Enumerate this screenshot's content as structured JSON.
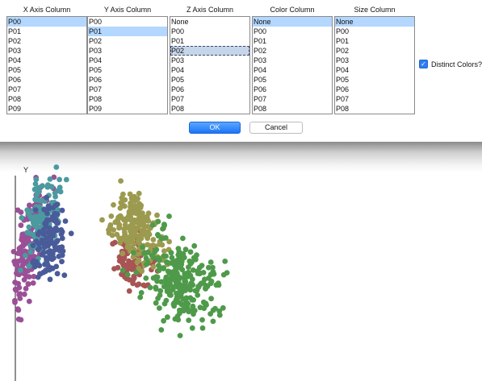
{
  "dialog": {
    "columns": [
      {
        "key": "x",
        "title": "X Axis Column",
        "items": [
          "P00",
          "P01",
          "P02",
          "P03",
          "P04",
          "P05",
          "P06",
          "P07",
          "P08",
          "P09"
        ],
        "selected": 0
      },
      {
        "key": "y",
        "title": "Y Axis Column",
        "items": [
          "P00",
          "P01",
          "P02",
          "P03",
          "P04",
          "P05",
          "P06",
          "P07",
          "P08",
          "P09"
        ],
        "selected": 1
      },
      {
        "key": "z",
        "title": "Z Axis Column",
        "items": [
          "None",
          "P00",
          "P01",
          "P02",
          "P03",
          "P04",
          "P05",
          "P06",
          "P07",
          "P08"
        ],
        "selected": 3
      },
      {
        "key": "color",
        "title": "Color Column",
        "items": [
          "None",
          "P00",
          "P01",
          "P02",
          "P03",
          "P04",
          "P05",
          "P06",
          "P07",
          "P08"
        ],
        "selected": 0
      },
      {
        "key": "size",
        "title": "Size Column",
        "items": [
          "None",
          "P00",
          "P01",
          "P02",
          "P03",
          "P04",
          "P05",
          "P06",
          "P07",
          "P08"
        ],
        "selected": 0
      }
    ],
    "distinct_colors_label": "Distinct Colors?",
    "distinct_colors_checked": true,
    "ok_label": "OK",
    "cancel_label": "Cancel"
  },
  "plot": {
    "axis_label_y": "Y",
    "cluster_colors": [
      "#9b4f96",
      "#4a9aa0",
      "#4a5b9a",
      "#a85454",
      "#9c9a4e",
      "#4e9a4a"
    ]
  }
}
